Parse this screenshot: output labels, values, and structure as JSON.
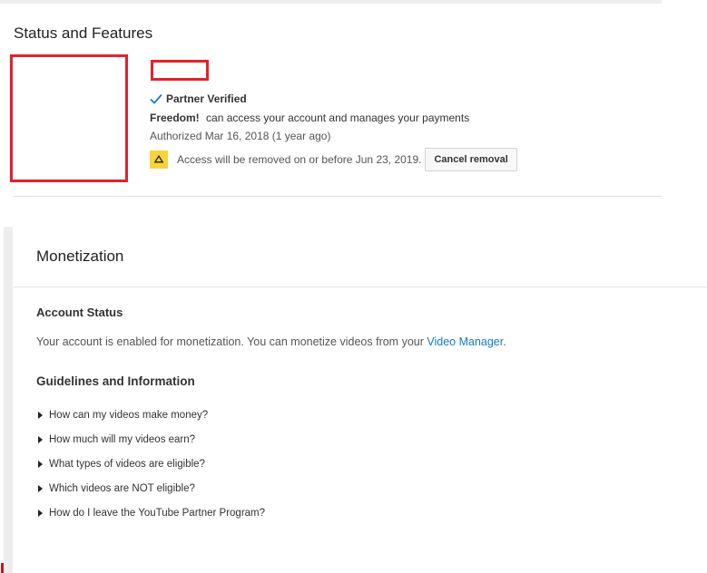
{
  "status_section": {
    "title": "Status and Features",
    "partner_label": "Partner Verified",
    "access_name": "Freedom!",
    "access_text": "can access your account and manages your payments",
    "authorized": "Authorized Mar 16, 2018 (1 year ago)",
    "removal_warning": "Access will be removed on or before Jun 23, 2019.",
    "cancel_button": "Cancel removal"
  },
  "monetization": {
    "title": "Monetization",
    "account_status_title": "Account Status",
    "account_status_text": "Your account is enabled for monetization. You can monetize videos from your ",
    "account_status_link": "Video Manager",
    "account_status_end": ".",
    "guidelines_title": "Guidelines and Information",
    "faq": [
      "How can my videos make money?",
      "How much will my videos earn?",
      "What types of videos are eligible?",
      "Which videos are NOT eligible?",
      "How do I leave the YouTube Partner Program?"
    ]
  },
  "colors": {
    "accent_link": "#167ac6",
    "redaction": "#e3212b",
    "warning": "#f9d33b",
    "check": "#1a73e8"
  },
  "icons": {
    "partner": "check-icon",
    "warning": "warning-triangle-icon",
    "faq": "triangle-right-icon"
  }
}
